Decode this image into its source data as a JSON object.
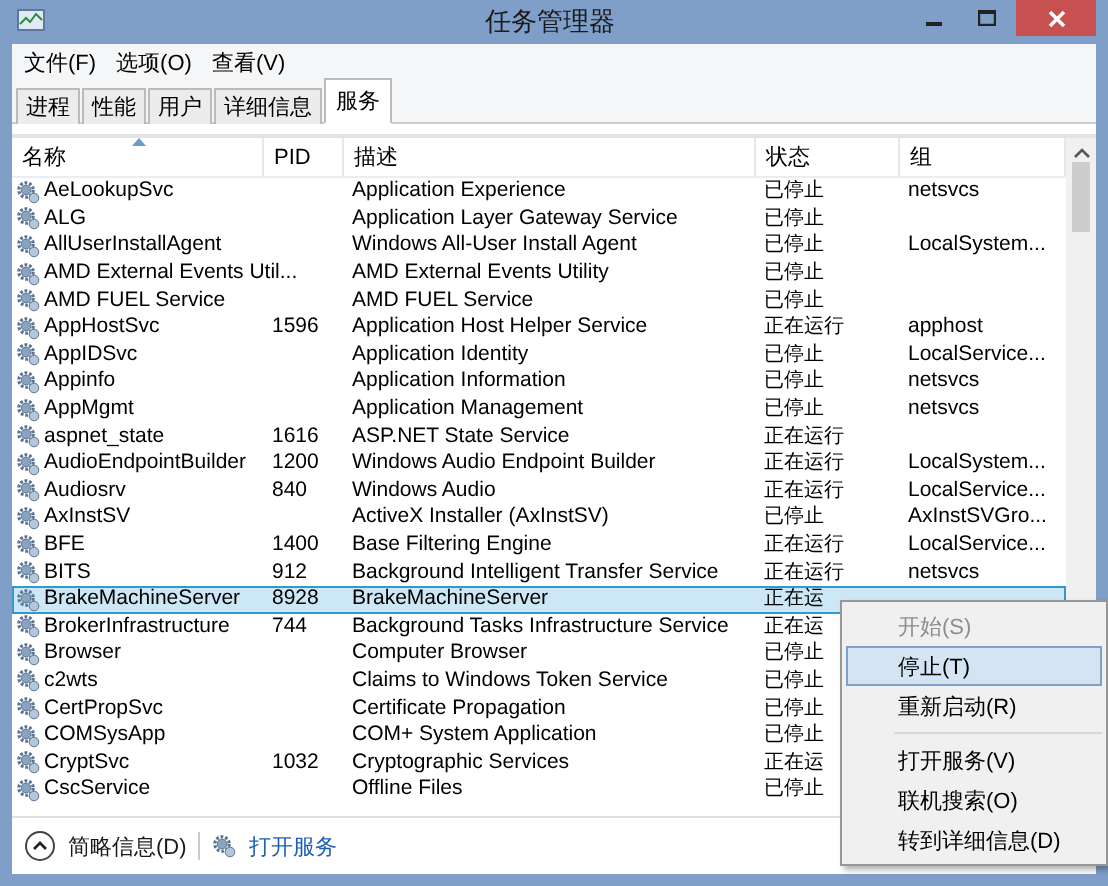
{
  "window": {
    "title": "任务管理器"
  },
  "menu_bar": [
    "文件(F)",
    "选项(O)",
    "查看(V)"
  ],
  "tabs": [
    {
      "label": "进程",
      "selected": false
    },
    {
      "label": "性能",
      "selected": false
    },
    {
      "label": "用户",
      "selected": false
    },
    {
      "label": "详细信息",
      "selected": false
    },
    {
      "label": "服务",
      "selected": true
    }
  ],
  "table": {
    "columns": [
      {
        "label": "名称",
        "sorted": true
      },
      {
        "label": "PID",
        "sorted": false
      },
      {
        "label": "描述",
        "sorted": false
      },
      {
        "label": "状态",
        "sorted": false
      },
      {
        "label": "组",
        "sorted": false
      }
    ],
    "rows": [
      {
        "name": "AeLookupSvc",
        "pid": "",
        "description": "Application Experience",
        "status": "已停止",
        "group": "netsvcs",
        "selected": false
      },
      {
        "name": "ALG",
        "pid": "",
        "description": "Application Layer Gateway Service",
        "status": "已停止",
        "group": "",
        "selected": false
      },
      {
        "name": "AllUserInstallAgent",
        "pid": "",
        "description": "Windows All-User Install Agent",
        "status": "已停止",
        "group": "LocalSystem...",
        "selected": false
      },
      {
        "name": "AMD External Events Util...",
        "pid": "",
        "description": "AMD External Events Utility",
        "status": "已停止",
        "group": "",
        "selected": false
      },
      {
        "name": "AMD FUEL Service",
        "pid": "",
        "description": "AMD FUEL Service",
        "status": "已停止",
        "group": "",
        "selected": false
      },
      {
        "name": "AppHostSvc",
        "pid": "1596",
        "description": "Application Host Helper Service",
        "status": "正在运行",
        "group": "apphost",
        "selected": false
      },
      {
        "name": "AppIDSvc",
        "pid": "",
        "description": "Application Identity",
        "status": "已停止",
        "group": "LocalService...",
        "selected": false
      },
      {
        "name": "Appinfo",
        "pid": "",
        "description": "Application Information",
        "status": "已停止",
        "group": "netsvcs",
        "selected": false
      },
      {
        "name": "AppMgmt",
        "pid": "",
        "description": "Application Management",
        "status": "已停止",
        "group": "netsvcs",
        "selected": false
      },
      {
        "name": "aspnet_state",
        "pid": "1616",
        "description": "ASP.NET State Service",
        "status": "正在运行",
        "group": "",
        "selected": false
      },
      {
        "name": "AudioEndpointBuilder",
        "pid": "1200",
        "description": "Windows Audio Endpoint Builder",
        "status": "正在运行",
        "group": "LocalSystem...",
        "selected": false
      },
      {
        "name": "Audiosrv",
        "pid": "840",
        "description": "Windows Audio",
        "status": "正在运行",
        "group": "LocalService...",
        "selected": false
      },
      {
        "name": "AxInstSV",
        "pid": "",
        "description": "ActiveX Installer (AxInstSV)",
        "status": "已停止",
        "group": "AxInstSVGro...",
        "selected": false
      },
      {
        "name": "BFE",
        "pid": "1400",
        "description": "Base Filtering Engine",
        "status": "正在运行",
        "group": "LocalService...",
        "selected": false
      },
      {
        "name": "BITS",
        "pid": "912",
        "description": "Background Intelligent Transfer Service",
        "status": "正在运行",
        "group": "netsvcs",
        "selected": false
      },
      {
        "name": "BrakeMachineServer",
        "pid": "8928",
        "description": "BrakeMachineServer",
        "status": "正在运",
        "group": "",
        "selected": true
      },
      {
        "name": "BrokerInfrastructure",
        "pid": "744",
        "description": "Background Tasks Infrastructure Service",
        "status": "正在运",
        "group": "",
        "selected": false
      },
      {
        "name": "Browser",
        "pid": "",
        "description": "Computer Browser",
        "status": "已停止",
        "group": "",
        "selected": false
      },
      {
        "name": "c2wts",
        "pid": "",
        "description": "Claims to Windows Token Service",
        "status": "已停止",
        "group": "",
        "selected": false
      },
      {
        "name": "CertPropSvc",
        "pid": "",
        "description": "Certificate Propagation",
        "status": "已停止",
        "group": "",
        "selected": false
      },
      {
        "name": "COMSysApp",
        "pid": "",
        "description": "COM+ System Application",
        "status": "已停止",
        "group": "",
        "selected": false
      },
      {
        "name": "CryptSvc",
        "pid": "1032",
        "description": "Cryptographic Services",
        "status": "正在运",
        "group": "",
        "selected": false
      },
      {
        "name": "CscService",
        "pid": "",
        "description": "Offline Files",
        "status": "已停止",
        "group": "",
        "selected": false
      }
    ]
  },
  "footer": {
    "details_toggle": "简略信息(D)",
    "open_services": "打开服务"
  },
  "context_menu": [
    {
      "kind": "item",
      "label": "开始(S)",
      "disabled": true,
      "highlighted": false
    },
    {
      "kind": "item",
      "label": "停止(T)",
      "disabled": false,
      "highlighted": true
    },
    {
      "kind": "item",
      "label": "重新启动(R)",
      "disabled": false,
      "highlighted": false
    },
    {
      "kind": "separator"
    },
    {
      "kind": "item",
      "label": "打开服务(V)",
      "disabled": false,
      "highlighted": false
    },
    {
      "kind": "item",
      "label": "联机搜索(O)",
      "disabled": false,
      "highlighted": false
    },
    {
      "kind": "item",
      "label": "转到详细信息(D)",
      "disabled": false,
      "highlighted": false
    }
  ]
}
